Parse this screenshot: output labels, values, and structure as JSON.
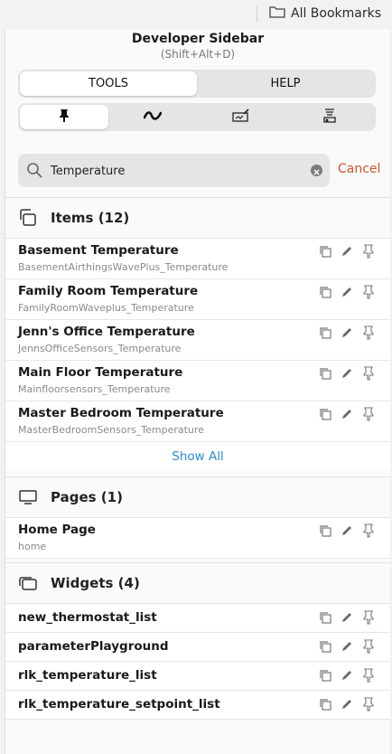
{
  "browser": {
    "bookmarks_label": "All Bookmarks"
  },
  "header": {
    "title": "Developer Sidebar",
    "shortcut": "(Shift+Alt+D)"
  },
  "tabs": [
    {
      "label": "TOOLS",
      "active": true
    },
    {
      "label": "HELP",
      "active": false
    }
  ],
  "toolbar": [
    {
      "icon": "pin-icon",
      "active": true
    },
    {
      "icon": "activity-icon",
      "active": false
    },
    {
      "icon": "signature-icon",
      "active": false
    },
    {
      "icon": "flask-icon",
      "active": false
    }
  ],
  "search": {
    "value": "Temperature",
    "cancel_label": "Cancel"
  },
  "items": {
    "title": "Items (12)",
    "rows": [
      {
        "name": "Basement Temperature",
        "sub": "BasementAirthingsWavePlus_Temperature"
      },
      {
        "name": "Family Room Temperature",
        "sub": "FamilyRoomWaveplus_Temperature"
      },
      {
        "name": "Jenn's Office Temperature",
        "sub": "JennsOfficeSensors_Temperature"
      },
      {
        "name": "Main Floor Temperature",
        "sub": "Mainfloorsensors_Temperature"
      },
      {
        "name": "Master Bedroom Temperature",
        "sub": "MasterBedroomSensors_Temperature"
      }
    ],
    "show_all": "Show All"
  },
  "pages": {
    "title": "Pages (1)",
    "rows": [
      {
        "name": "Home Page",
        "sub": "home"
      }
    ]
  },
  "widgets": {
    "title": "Widgets (4)",
    "rows": [
      {
        "name": "new_thermostat_list"
      },
      {
        "name": "parameterPlayground"
      },
      {
        "name": "rlk_temperature_list"
      },
      {
        "name": "rlk_temperature_setpoint_list"
      }
    ]
  },
  "colors": {
    "accent_blue": "#2b8bd6",
    "cancel_red": "#d0552e"
  }
}
